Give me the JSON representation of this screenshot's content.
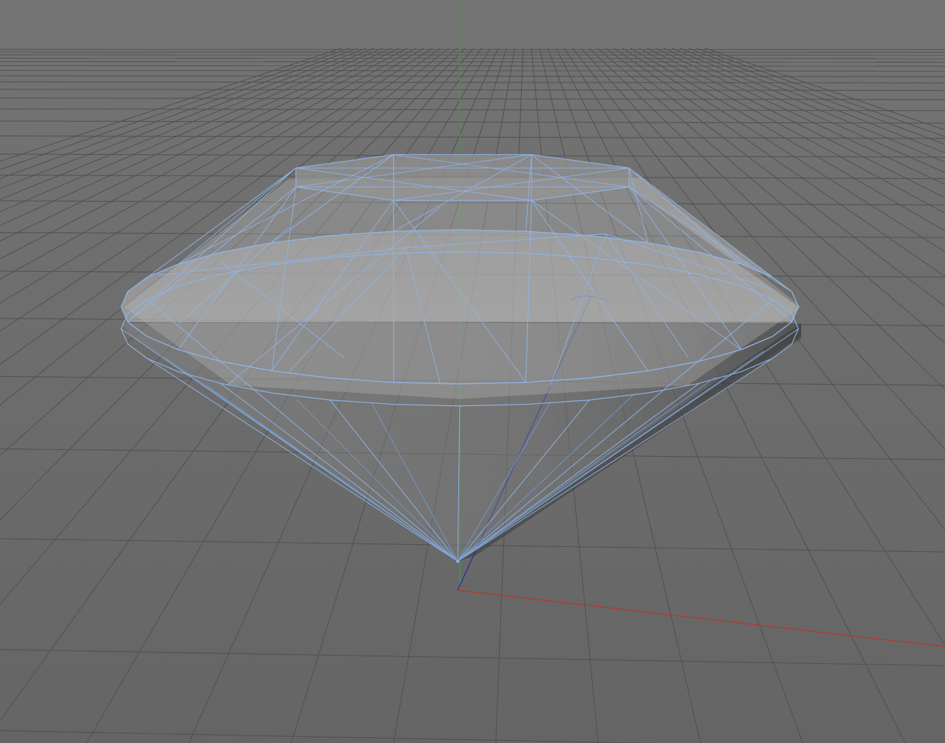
{
  "viewport": {
    "background_color": "#6b6b6b",
    "grid_color": "#515151",
    "axis_colors": {
      "x": "#b23a2c",
      "y": "#2fa13a",
      "z": "#2a2ab0"
    },
    "wireframe_color": "#8fb4e6",
    "selection_color": "#6f9bd6",
    "object": "diamond-wireframe",
    "grid_visible": true,
    "world_axes_visible": true
  }
}
